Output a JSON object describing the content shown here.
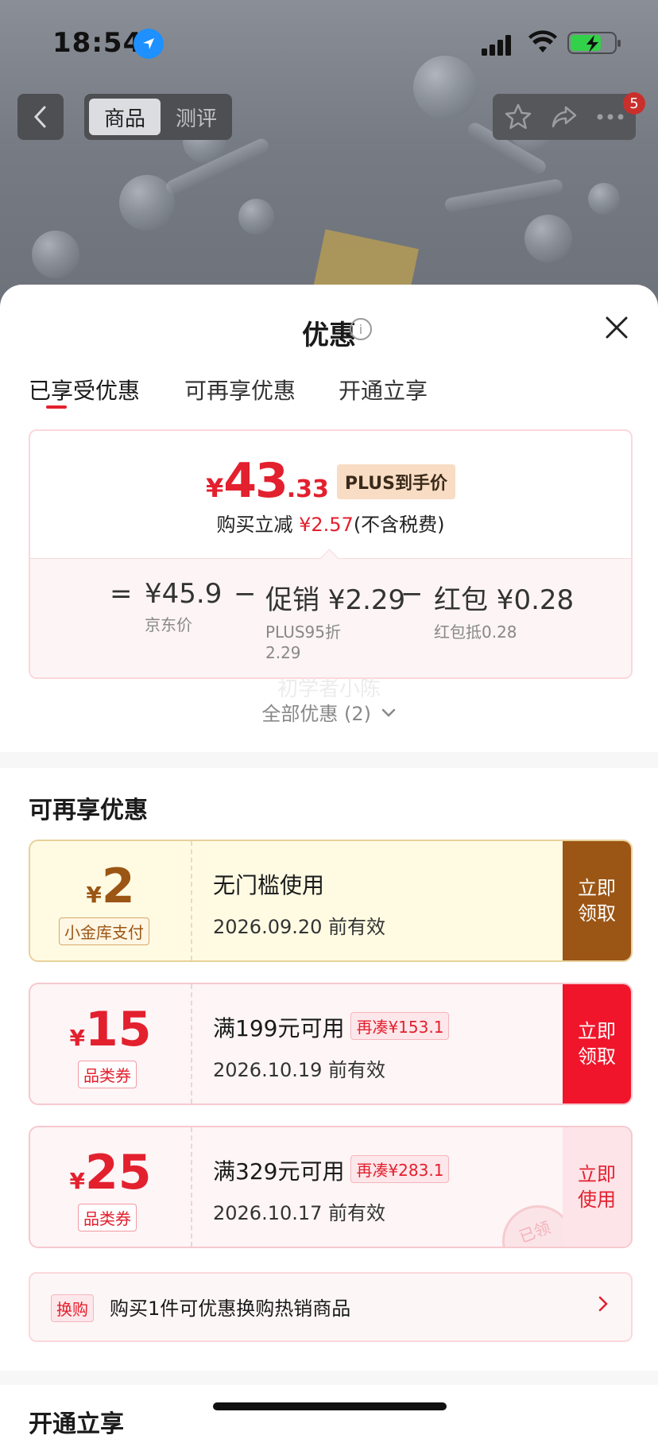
{
  "status_bar": {
    "time": "18:54"
  },
  "nav": {
    "tabs": [
      "商品",
      "测评"
    ],
    "cart_badge": "5"
  },
  "sheet": {
    "title": "优惠",
    "tabs": [
      "已享受优惠",
      "可再享优惠",
      "开通立享"
    ]
  },
  "summary": {
    "yen": "¥",
    "price_int": "43",
    "price_dec": ".33",
    "price_tag": "PLUS到手价",
    "reduce_prefix": "购买立减 ",
    "reduce_amount": "¥2.57",
    "reduce_suffix": "(不含税费)",
    "eq": "=",
    "minus": "−",
    "items": [
      {
        "value": "¥45.9",
        "label": "京东价"
      },
      {
        "value": "促销 ¥2.29",
        "label": "PLUS95折",
        "label2": "2.29"
      },
      {
        "value": "红包 ¥0.28",
        "label": "红包抵0.28"
      }
    ],
    "all_promotions": "全部优惠 (2)",
    "watermark": "初学者小陈"
  },
  "available": {
    "title": "可再享优惠",
    "coupons": [
      {
        "yen": "¥",
        "amount": "2",
        "type": "小金库支付",
        "condition": "无门槛使用",
        "extra": "",
        "date": "2026.09.20 前有效",
        "action_line1": "立即",
        "action_line2": "领取"
      },
      {
        "yen": "¥",
        "amount": "15",
        "type": "品类券",
        "condition": "满199元可用",
        "extra": "再凑¥153.1",
        "date": "2026.10.19 前有效",
        "action_line1": "立即",
        "action_line2": "领取"
      },
      {
        "yen": "¥",
        "amount": "25",
        "type": "品类券",
        "condition": "满329元可用",
        "extra": "再凑¥283.1",
        "date": "2026.10.17 前有效",
        "action_line1": "立即",
        "action_line2": "使用",
        "stamp": "已领"
      }
    ],
    "swap": {
      "tag": "换购",
      "text": "购买1件可优惠换购热销商品"
    }
  },
  "open_section": {
    "title": "开通立享"
  },
  "colors": {
    "accent": "#e3202e",
    "gold": "#9b5514",
    "gold_bg": "#fffbe3"
  }
}
